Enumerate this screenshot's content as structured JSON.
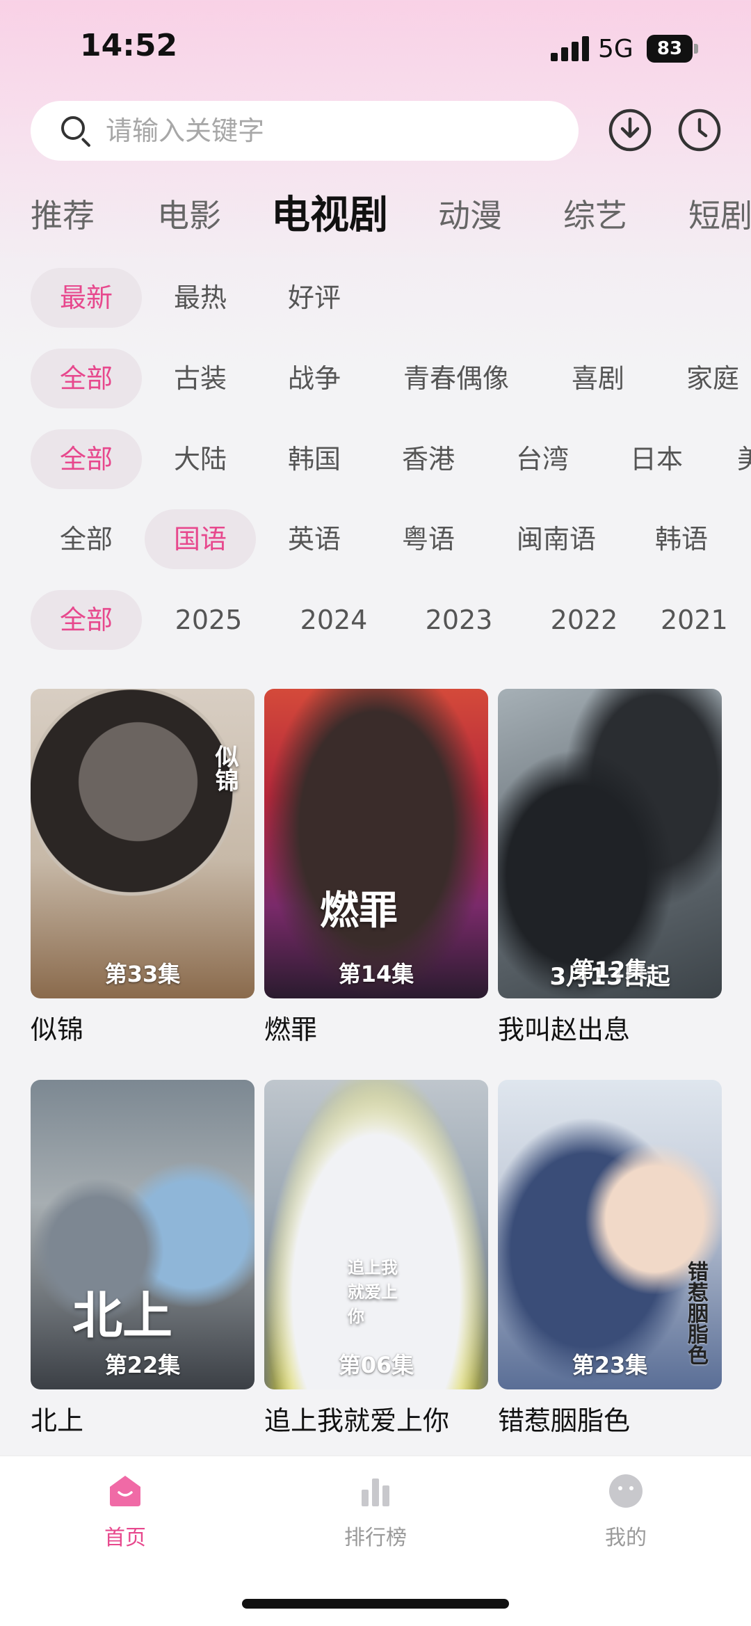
{
  "status_bar": {
    "time": "14:52",
    "network": "5G",
    "battery": "83"
  },
  "search": {
    "placeholder": "请输入关键字"
  },
  "category_tabs": [
    {
      "label": "推荐",
      "active": false
    },
    {
      "label": "电影",
      "active": false
    },
    {
      "label": "电视剧",
      "active": true
    },
    {
      "label": "动漫",
      "active": false
    },
    {
      "label": "综艺",
      "active": false
    },
    {
      "label": "短剧",
      "active": false
    }
  ],
  "filters": {
    "sort": [
      "最新",
      "最热",
      "好评"
    ],
    "genre": [
      "全部",
      "古装",
      "战争",
      "青春偶像",
      "喜剧",
      "家庭"
    ],
    "region": [
      "全部",
      "大陆",
      "韩国",
      "香港",
      "台湾",
      "日本",
      "美"
    ],
    "language": [
      "全部",
      "国语",
      "英语",
      "粤语",
      "闽南语",
      "韩语"
    ],
    "year": [
      "全部",
      "2025",
      "2024",
      "2023",
      "2022",
      "2021"
    ]
  },
  "shows": [
    {
      "title": "似锦",
      "episode": "第33集",
      "poster_text": "似锦"
    },
    {
      "title": "燃罪",
      "episode": "第14集",
      "poster_text": "燃罪"
    },
    {
      "title": "我叫赵出息",
      "episode": "第12集",
      "poster_text": "3月13日起"
    },
    {
      "title": "北上",
      "episode": "第22集",
      "poster_text": "北上"
    },
    {
      "title": "追上我就爱上你",
      "episode": "第06集",
      "poster_text": "追上我就爱上你"
    },
    {
      "title": "错惹胭脂色",
      "episode": "第23集",
      "poster_text": "错惹胭脂色"
    }
  ],
  "bottom_nav": [
    {
      "label": "首页",
      "icon": "home-icon",
      "active": true
    },
    {
      "label": "排行榜",
      "icon": "ranking-icon",
      "active": false
    },
    {
      "label": "我的",
      "icon": "profile-icon",
      "active": false
    }
  ],
  "colors": {
    "accent": "#e7488d",
    "chip_bg": "#ebe5ea"
  }
}
